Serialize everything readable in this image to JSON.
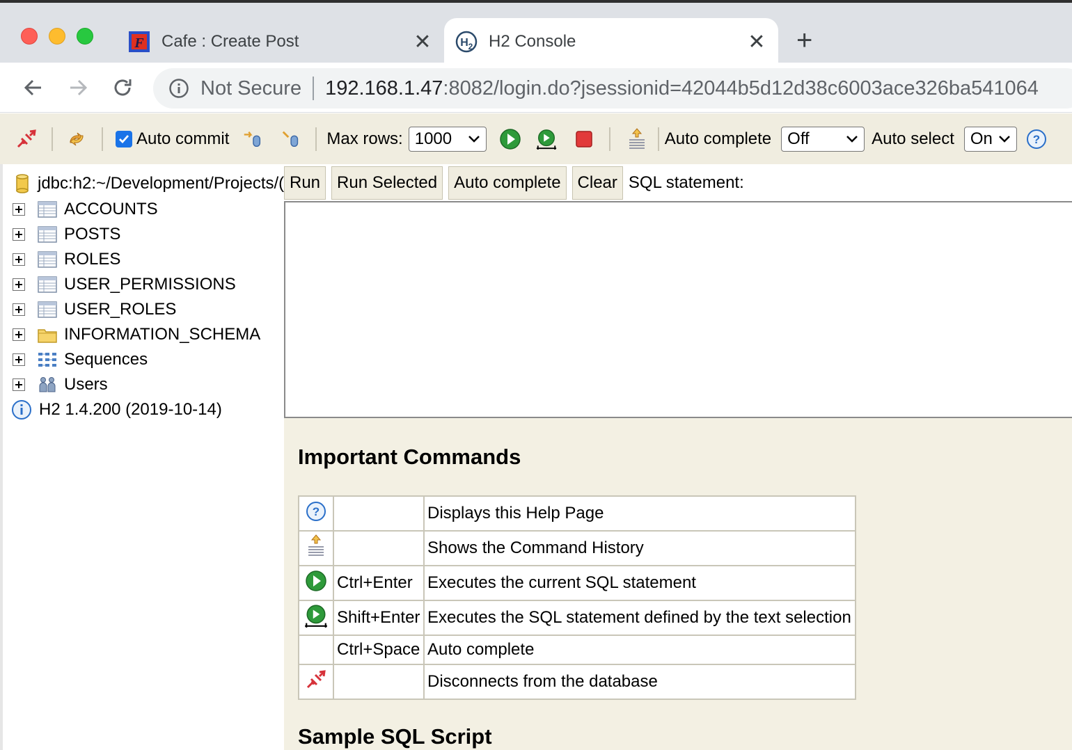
{
  "browser": {
    "tabs": [
      {
        "title": "Cafe : Create Post",
        "favicon": "cafe-favicon",
        "active": false
      },
      {
        "title": "H2 Console",
        "favicon": "h2-favicon",
        "active": true
      }
    ],
    "address": {
      "security_label": "Not Secure",
      "host": "192.168.1.47",
      "rest": ":8082/login.do?jsessionid=42044b5d12d38c6003ace326ba541064"
    }
  },
  "h2_toolbar": {
    "auto_commit_label": "Auto commit",
    "auto_commit_checked": true,
    "max_rows_label": "Max rows:",
    "max_rows_value": "1000",
    "auto_complete_label": "Auto complete",
    "auto_complete_value": "Off",
    "auto_select_label": "Auto select",
    "auto_select_value": "On"
  },
  "tree": {
    "connection": "jdbc:h2:~/Development/Projects/(",
    "items": [
      {
        "label": "ACCOUNTS",
        "icon": "table-icon"
      },
      {
        "label": "POSTS",
        "icon": "table-icon"
      },
      {
        "label": "ROLES",
        "icon": "table-icon"
      },
      {
        "label": "USER_PERMISSIONS",
        "icon": "table-icon"
      },
      {
        "label": "USER_ROLES",
        "icon": "table-icon"
      },
      {
        "label": "INFORMATION_SCHEMA",
        "icon": "folder-icon"
      },
      {
        "label": "Sequences",
        "icon": "sequences-icon"
      },
      {
        "label": "Users",
        "icon": "users-icon"
      }
    ],
    "version": "H2 1.4.200 (2019-10-14)"
  },
  "query": {
    "run": "Run",
    "run_selected": "Run Selected",
    "auto_complete": "Auto complete",
    "clear": "Clear",
    "sql_label": "SQL statement:",
    "sql_text": ""
  },
  "help": {
    "important_title": "Important Commands",
    "commands": [
      {
        "icon": "help-icon",
        "key": "",
        "desc": "Displays this Help Page"
      },
      {
        "icon": "history-icon",
        "key": "",
        "desc": "Shows the Command History"
      },
      {
        "icon": "run-icon",
        "key": "Ctrl+Enter",
        "desc": "Executes the current SQL statement"
      },
      {
        "icon": "run-selected-icon",
        "key": "Shift+Enter",
        "desc": "Executes the SQL statement defined by the text selection"
      },
      {
        "icon": "",
        "key": "Ctrl+Space",
        "desc": "Auto complete"
      },
      {
        "icon": "disconnect-icon",
        "key": "",
        "desc": "Disconnects from the database"
      }
    ],
    "sample_title": "Sample SQL Script"
  }
}
